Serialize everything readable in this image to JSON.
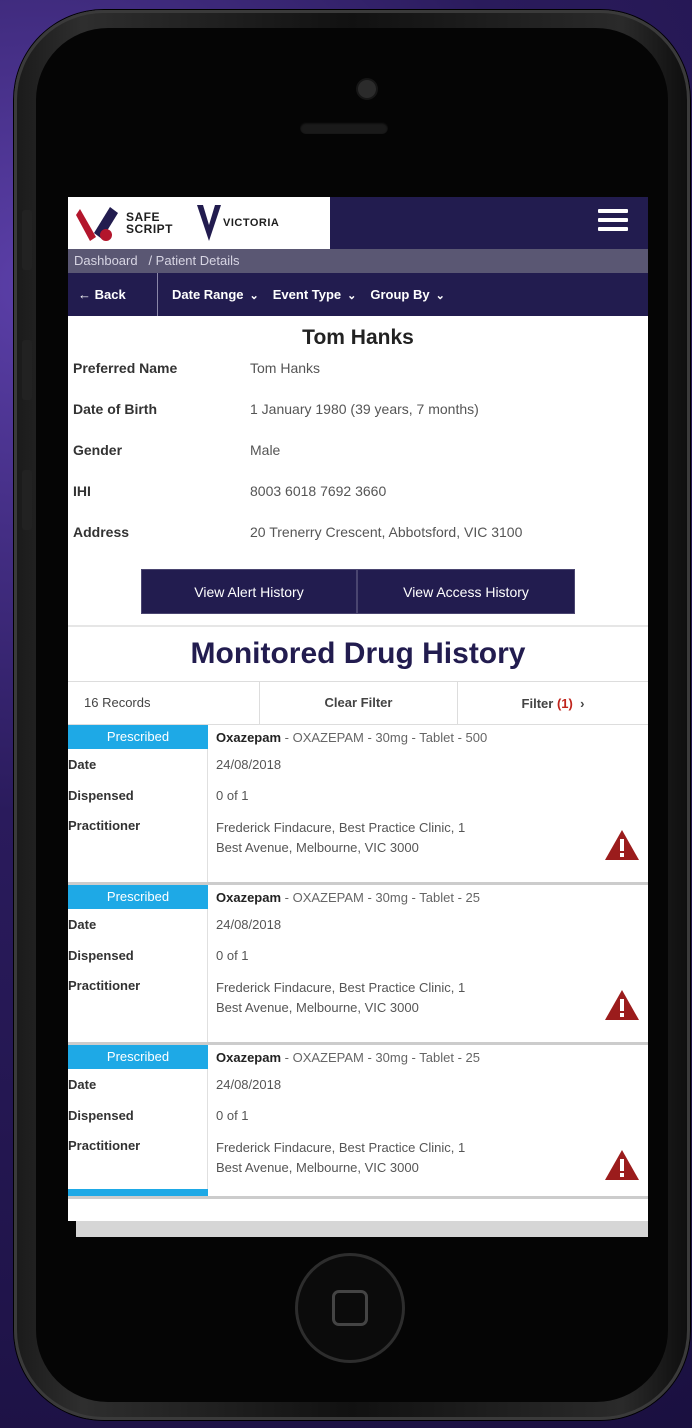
{
  "app": {
    "logo_safe": "SAFE",
    "logo_script": "SCRIPT",
    "logo_victoria": "VICTORIA",
    "menu_icon": "hamburger-menu-icon"
  },
  "breadcrumb": {
    "home": "Dashboard",
    "current": "/ Patient Details"
  },
  "toolbar": {
    "back": "Back",
    "date_range": "Date Range",
    "event_type": "Event Type",
    "group_by": "Group By"
  },
  "patient": {
    "name": "Tom Hanks",
    "fields": [
      {
        "label": "Preferred Name",
        "value": "Tom Hanks"
      },
      {
        "label": "Date of Birth",
        "value": "1 January 1980  (39 years, 7 months)"
      },
      {
        "label": "Gender",
        "value": "Male"
      },
      {
        "label": "IHI",
        "value": "8003 6018 7692 3660"
      },
      {
        "label": "Address",
        "value": "20 Trenerry Crescent, Abbotsford, VIC 3100"
      }
    ]
  },
  "buttons": {
    "alert_history": "View Alert History",
    "access_history": "View Access History"
  },
  "history": {
    "title": "Monitored Drug History",
    "records": "16 Records",
    "clear_filter": "Clear Filter",
    "filter_label": "Filter",
    "filter_count": "(1)",
    "labels": {
      "date": "Date",
      "dispensed": "Dispensed",
      "practitioner": "Practitioner"
    },
    "cards": [
      {
        "status": "Prescribed",
        "drug": "Oxazepam",
        "detail": " - OXAZEPAM - 30mg - Tablet - 500",
        "date": "24/08/2018",
        "dispensed": "0 of 1",
        "practitioner_line1": "Frederick Findacure, Best Practice Clinic, 1",
        "practitioner_line2": "Best Avenue, Melbourne, VIC 3000"
      },
      {
        "status": "Prescribed",
        "drug": "Oxazepam",
        "detail": " - OXAZEPAM - 30mg - Tablet - 25",
        "date": "24/08/2018",
        "dispensed": "0 of 1",
        "practitioner_line1": "Frederick Findacure, Best Practice Clinic, 1",
        "practitioner_line2": "Best Avenue, Melbourne, VIC 3000"
      },
      {
        "status": "Prescribed",
        "drug": "Oxazepam",
        "detail": " - OXAZEPAM - 30mg - Tablet - 25",
        "date": "24/08/2018",
        "dispensed": "0 of 1",
        "practitioner_line1": "Frederick Findacure, Best Practice Clinic, 1",
        "practitioner_line2": "Best Avenue, Melbourne, VIC 3000"
      }
    ]
  },
  "colors": {
    "navy": "#221c4f",
    "badge_blue": "#1ea9e6",
    "warning_red": "#9b1c1c",
    "breadcrumb_bg": "#5a5773"
  }
}
